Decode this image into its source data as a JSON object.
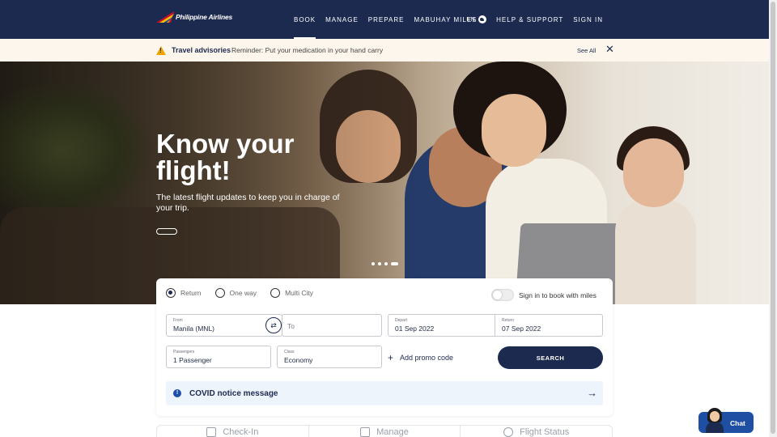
{
  "header": {
    "logo_text": "Philippine Airlines",
    "nav": [
      {
        "label": "BOOK",
        "active": true
      },
      {
        "label": "MANAGE",
        "active": false
      },
      {
        "label": "PREPARE",
        "active": false
      },
      {
        "label": "MABUHAY MILES",
        "active": false
      }
    ],
    "language": "EN",
    "help_label": "HELP & SUPPORT",
    "signin_label": "SIGN IN"
  },
  "advisory": {
    "title": "Travel advisories",
    "message": "Reminder: Put your medication in your hand carry",
    "see_all": "See All",
    "close_symbol": "✕"
  },
  "hero": {
    "title": "Know your flight!",
    "subtitle": "The latest flight updates to keep you in charge of your trip.",
    "slides": 4,
    "active_slide": 4
  },
  "booking": {
    "trip_types": [
      {
        "label": "Return",
        "checked": true
      },
      {
        "label": "One way",
        "checked": false
      },
      {
        "label": "Multi City",
        "checked": false
      }
    ],
    "miles_toggle_label": "Sign in to book with miles",
    "from": {
      "label": "From",
      "value": "Manila (MNL)"
    },
    "to": {
      "placeholder": "To"
    },
    "depart": {
      "label": "Depart",
      "value": "01 Sep 2022"
    },
    "return": {
      "label": "Return",
      "value": "07 Sep 2022"
    },
    "passengers": {
      "label": "Passengers",
      "value": "1 Passenger"
    },
    "class": {
      "label": "Class",
      "value": "Economy"
    },
    "promo_label": "Add promo code",
    "search_label": "SEARCH",
    "swap_symbol": "⇄",
    "promo_symbol": "+"
  },
  "covid": {
    "icon_symbol": "!",
    "text": "COVID notice message",
    "arrow_symbol": "→"
  },
  "tabs": [
    {
      "label": "Check-In",
      "icon": "checkin-icon"
    },
    {
      "label": "Manage",
      "icon": "luggage-icon"
    },
    {
      "label": "Flight Status",
      "icon": "clock-icon"
    }
  ],
  "chat": {
    "label": "Chat"
  },
  "colors": {
    "header_bg": "#1d2a50",
    "advisory_bg": "#fdf6ec",
    "warning": "#f0a500",
    "primary_button": "#1d2a50",
    "chat_bg": "#1f4fa3"
  }
}
